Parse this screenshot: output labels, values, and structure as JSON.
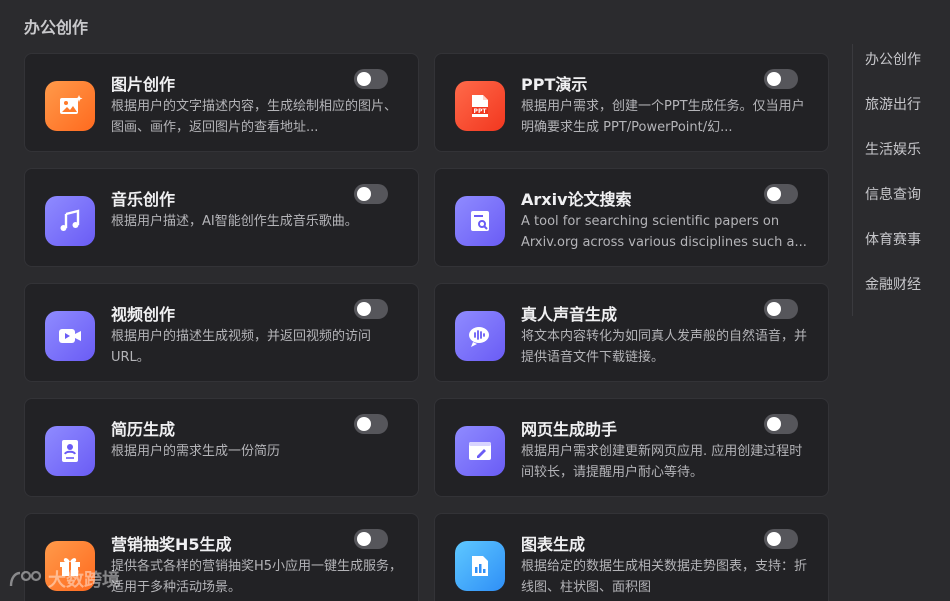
{
  "section_title": "办公创作",
  "cards": [
    {
      "title": "图片创作",
      "desc": "根据用户的文字描述内容，生成绘制相应的图片、图画、画作，返回图片的查看地址...",
      "icon": "image-sparkle-icon",
      "enabled": false
    },
    {
      "title": "PPT演示",
      "desc": "根据用户需求，创建一个PPT生成任务。仅当用户明确要求生成 PPT/PowerPoint/幻...",
      "icon": "ppt-file-icon",
      "enabled": false
    },
    {
      "title": "音乐创作",
      "desc": "根据用户描述，AI智能创作生成音乐歌曲。",
      "icon": "music-note-icon",
      "enabled": false
    },
    {
      "title": "Arxiv论文搜索",
      "desc": "A tool for searching scientific papers on Arxiv.org across various disciplines such a...",
      "icon": "paper-search-icon",
      "enabled": false
    },
    {
      "title": "视频创作",
      "desc": "根据用户的描述生成视频，并返回视频的访问URL。",
      "icon": "video-camera-icon",
      "enabled": false
    },
    {
      "title": "真人声音生成",
      "desc": "将文本内容转化为如同真人发声般的自然语音，并提供语音文件下载链接。",
      "icon": "voice-chat-icon",
      "enabled": false
    },
    {
      "title": "简历生成",
      "desc": "根据用户的需求生成一份简历",
      "icon": "resume-icon",
      "enabled": false
    },
    {
      "title": "网页生成助手",
      "desc": "根据用户需求创建更新网页应用. 应用创建过程时间较长，请提醒用户耐心等待。",
      "icon": "webpage-edit-icon",
      "enabled": false
    },
    {
      "title": "营销抽奖H5生成",
      "desc": "提供各式各样的营销抽奖H5小应用一键生成服务，适用于多种活动场景。",
      "icon": "gift-icon",
      "enabled": false
    },
    {
      "title": "图表生成",
      "desc": "根据给定的数据生成相关数据走势图表，支持：折线图、柱状图、面积图",
      "icon": "bar-chart-icon",
      "enabled": false
    }
  ],
  "side_nav": [
    "办公创作",
    "旅游出行",
    "生活娱乐",
    "信息查询",
    "体育赛事",
    "金融财经"
  ],
  "watermark": "大数跨境",
  "colors": {
    "background": "#2b2b2e",
    "card": "#222225",
    "toggle_off": "#56565b"
  }
}
